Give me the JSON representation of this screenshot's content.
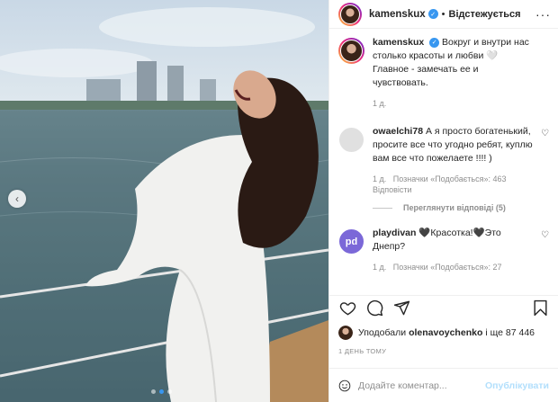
{
  "post": {
    "author": "kamenskux",
    "follow_label": "Відстежується",
    "caption_user": "kamenskux",
    "caption_text": "Вокруг и внутри нас столько красоты и любви 🤍 Главное - замечать ее и чувствовать.",
    "caption_age": "1 д."
  },
  "comments": [
    {
      "user": "owaelchi78",
      "text": "А я просто богатенький, просите все что угодно ребят, куплю вам все что пожелаете !!!! )",
      "age": "1 д.",
      "likes_meta": "Позначки «Подобається»: 463",
      "reply_label": "Відповісти",
      "view_replies": "Переглянути відповіді (5)"
    },
    {
      "user": "playdivan",
      "text": "🖤Красотка!🖤Это Днепр?",
      "age": "1 д.",
      "likes_meta": "Позначки «Подобається»: 27"
    }
  ],
  "likes": {
    "prefix": "Уподобали",
    "user": "olenavoychenko",
    "suffix": "і ще 87 446"
  },
  "date_label": "1 ДЕНЬ ТОМУ",
  "composer": {
    "placeholder": "Додайте коментар...",
    "publish_label": "Опублікувати"
  },
  "icons": {
    "verified": "verified-badge-icon",
    "like": "heart-icon",
    "comment": "comment-icon",
    "share": "paper-plane-icon",
    "save": "bookmark-icon",
    "emoji": "smiley-icon",
    "prev": "chevron-left-icon"
  },
  "colors": {
    "link_blue": "#3897f0",
    "publish_disabled": "#b2dffc",
    "meta_gray": "#8e8e8e"
  },
  "carousel": {
    "slides": 3,
    "active_slide": 2
  }
}
